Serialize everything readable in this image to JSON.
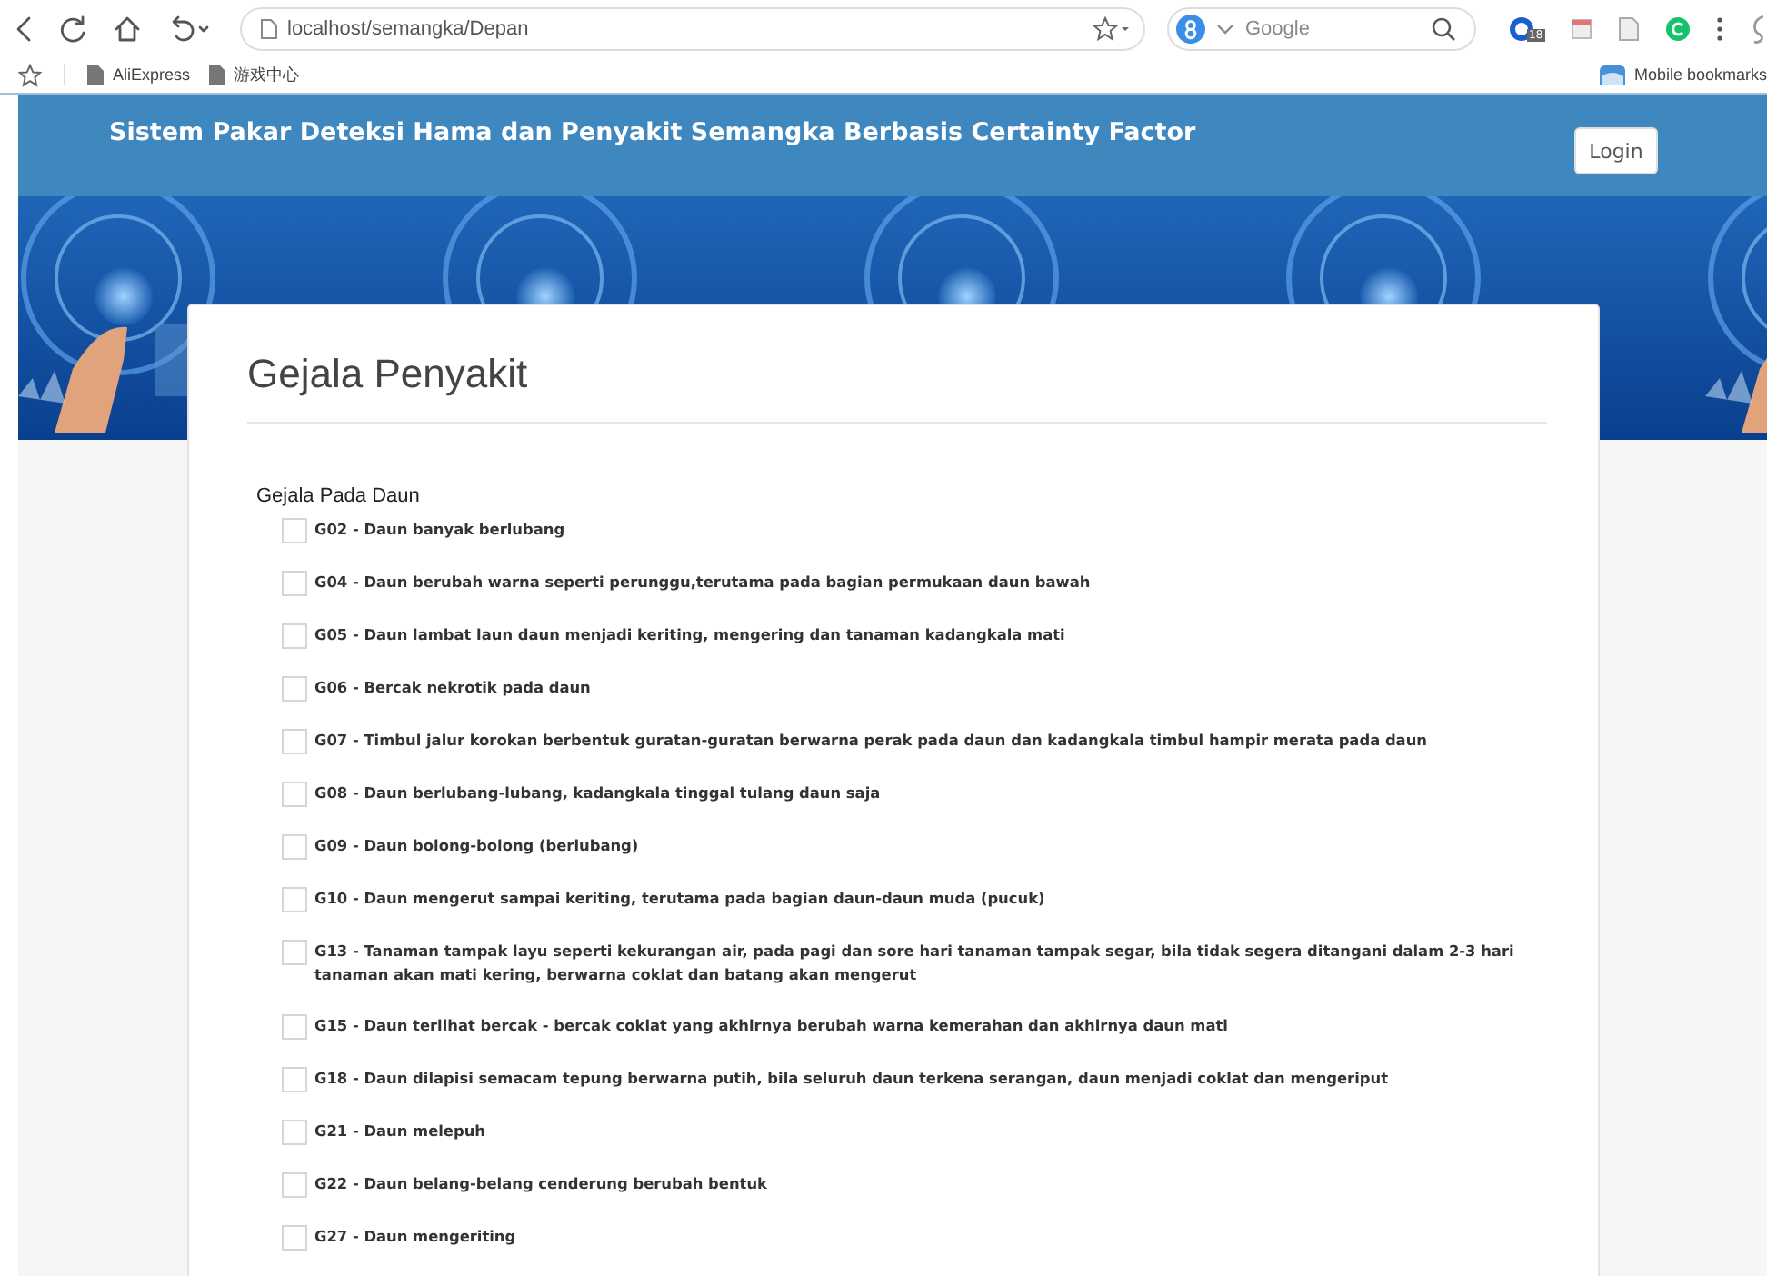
{
  "browser": {
    "address": "localhost/semangka/Depan",
    "search_placeholder": "Google",
    "extension_badge": "18",
    "bookmarks": [
      "AliExpress",
      "游戏中心"
    ],
    "mobile_bookmarks": "Mobile bookmarks"
  },
  "header": {
    "title": "Sistem Pakar Deteksi Hama dan Penyakit Semangka Berbasis Certainty Factor",
    "login_button": "Login"
  },
  "card": {
    "title": "Gejala Penyakit",
    "sections": [
      {
        "title": "Gejala Pada Daun",
        "symptoms": [
          {
            "label": "G02 - Daun banyak berlubang",
            "checked": false
          },
          {
            "label": "G04 - Daun berubah warna seperti perunggu,terutama pada bagian permukaan daun bawah",
            "checked": false
          },
          {
            "label": "G05 - Daun lambat laun daun menjadi keriting, mengering dan tanaman kadangkala mati",
            "checked": false
          },
          {
            "label": "G06 - Bercak nekrotik pada daun",
            "checked": false
          },
          {
            "label": "G07 - Timbul jalur korokan berbentuk guratan-guratan berwarna perak pada daun dan kadangkala timbul hampir merata pada daun",
            "checked": false
          },
          {
            "label": "G08 - Daun berlubang-lubang, kadangkala tinggal tulang daun saja",
            "checked": false
          },
          {
            "label": "G09 - Daun bolong-bolong (berlubang)",
            "checked": false
          },
          {
            "label": "G10 - Daun mengerut sampai keriting, terutama pada bagian daun-daun muda (pucuk)",
            "checked": false
          },
          {
            "label": "G13 - Tanaman tampak layu seperti kekurangan air, pada pagi dan sore hari tanaman tampak segar, bila tidak segera ditangani dalam 2-3 hari tanaman akan mati kering, berwarna coklat dan batang akan mengerut",
            "checked": false
          },
          {
            "label": "G15 - Daun terlihat bercak - bercak coklat yang akhirnya berubah warna kemerahan dan akhirnya daun mati",
            "checked": false
          },
          {
            "label": "G18 - Daun dilapisi semacam tepung berwarna putih, bila seluruh daun terkena serangan, daun menjadi coklat dan mengeriput",
            "checked": false
          },
          {
            "label": "G21 - Daun melepuh",
            "checked": false
          },
          {
            "label": "G22 - Daun belang-belang cenderung berubah bentuk",
            "checked": false
          },
          {
            "label": "G27 - Daun mengeriting",
            "checked": false
          }
        ]
      }
    ]
  }
}
